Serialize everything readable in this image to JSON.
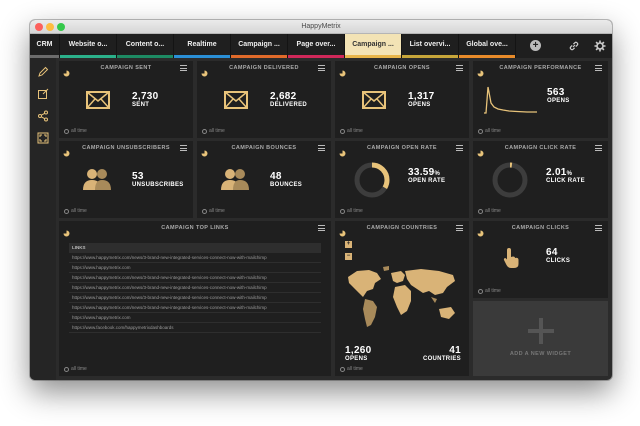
{
  "window": {
    "title": "HappyMetrix"
  },
  "tabs": [
    {
      "label": "CRM",
      "color": "#6c6c6c",
      "width": 30
    },
    {
      "label": "Website o...",
      "color": "#2bb08a",
      "width": 57
    },
    {
      "label": "Content o...",
      "color": "#1d8a63",
      "width": 57
    },
    {
      "label": "Realtime",
      "color": "#2a8fd6",
      "width": 57
    },
    {
      "label": "Campaign ...",
      "color": "#e06a2a",
      "width": 57
    },
    {
      "label": "Page over...",
      "color": "#d0285a",
      "width": 57
    },
    {
      "label": "Campaign ...",
      "color": "#e8b54a",
      "width": 57,
      "active": true
    },
    {
      "label": "List overvi...",
      "color": "#c7a63a",
      "width": 57
    },
    {
      "label": "Global ove...",
      "color": "#e88b2a",
      "width": 57
    }
  ],
  "colors": {
    "accent": "#e8c37a",
    "panel": "#1f1f1f"
  },
  "footer_label": "all time",
  "panels": {
    "sent": {
      "title": "CAMPAIGN SENT",
      "value": "2,730",
      "label": "SENT"
    },
    "delivered": {
      "title": "CAMPAIGN DELIVERED",
      "value": "2,682",
      "label": "DELIVERED"
    },
    "opens": {
      "title": "CAMPAIGN OPENS",
      "value": "1,317",
      "label": "OPENS"
    },
    "performance": {
      "title": "CAMPAIGN PERFORMANCE",
      "value": "563",
      "label": "OPENS"
    },
    "unsubscribers": {
      "title": "CAMPAIGN UNSUBSCRIBERS",
      "value": "53",
      "label": "UNSUBSCRIBES"
    },
    "bounces": {
      "title": "CAMPAIGN BOUNCES",
      "value": "48",
      "label": "BOUNCES"
    },
    "open_rate": {
      "title": "CAMPAIGN OPEN RATE",
      "value": "33.59",
      "unit": "%",
      "label": "OPEN RATE",
      "fraction": 0.3359
    },
    "click_rate": {
      "title": "CAMPAIGN CLICK RATE",
      "value": "2.01",
      "unit": "%",
      "label": "CLICK RATE",
      "fraction": 0.0201
    },
    "top_links": {
      "title": "CAMPAIGN TOP LINKS",
      "header": "LINKS",
      "rows": [
        "https://www.happymetrix.com/news/3-brand-new-integrated-services-connect-now-with-mailchimp",
        "https://www.happymetrix.com",
        "https://www.happymetrix.com/news/3-brand-new-integrated-services-connect-now-with-mailchimp",
        "https://www.happymetrix.com/news/3-brand-new-integrated-services-connect-now-with-mailchimp",
        "https://www.happymetrix.com/news/3-brand-new-integrated-services-connect-now-with-mailchimp",
        "https://www.happymetrix.com/news/3-brand-new-integrated-services-connect-now-with-mailchimp",
        "https://www.happymetrix.com",
        "https://www.facebook.com/happymetrixdashboards"
      ]
    },
    "countries": {
      "title": "CAMPAIGN COUNTRIES",
      "opens_value": "1,260",
      "opens_label": "OPENS",
      "countries_value": "41",
      "countries_label": "COUNTRIES"
    },
    "clicks": {
      "title": "CAMPAIGN CLICKS",
      "value": "64",
      "label": "CLICKS"
    },
    "add_widget": {
      "label": "ADD A NEW WIDGET"
    }
  }
}
